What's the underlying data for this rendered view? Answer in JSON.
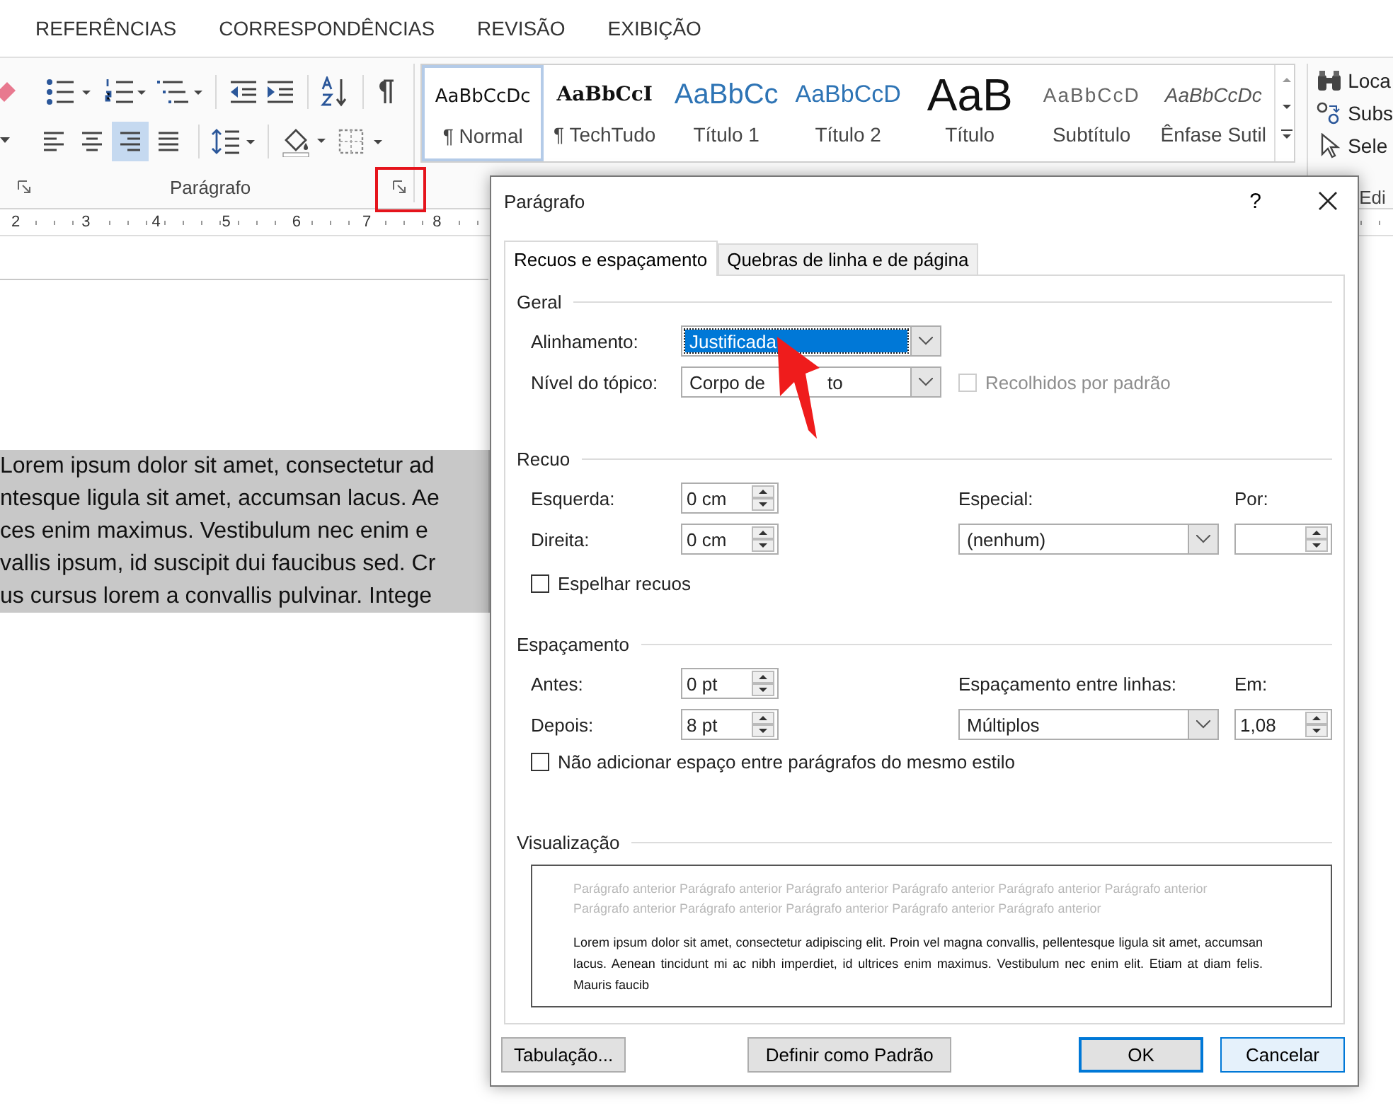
{
  "ribbon_tabs": [
    {
      "label": "REFERÊNCIAS"
    },
    {
      "label": "CORRESPONDÊNCIAS"
    },
    {
      "label": "REVISÃO"
    },
    {
      "label": "EXIBIÇÃO"
    }
  ],
  "paragraph_group": {
    "label": "Parágrafo",
    "launcher_highlighted": true,
    "alignment_buttons": [
      {
        "kind": "left",
        "selected": false
      },
      {
        "kind": "center",
        "selected": false
      },
      {
        "kind": "right",
        "selected": true
      },
      {
        "kind": "justify",
        "selected": false
      }
    ]
  },
  "styles": [
    {
      "sample": "AaBbCcDc",
      "name": "¶ Normal",
      "kind": "normal",
      "selected": true
    },
    {
      "sample": "AaBbCcI",
      "name": "¶ TechTudo",
      "kind": "custom",
      "selected": false
    },
    {
      "sample": "AaBbCc",
      "name": "Título 1",
      "kind": "heading1",
      "selected": false
    },
    {
      "sample": "AaBbCcD",
      "name": "Título 2",
      "kind": "heading2",
      "selected": false
    },
    {
      "sample": "AaB",
      "name": "Título",
      "kind": "title",
      "selected": false
    },
    {
      "sample": "AaBbCcD",
      "name": "Subtítulo",
      "kind": "subtitle",
      "selected": false
    },
    {
      "sample": "AaBbCcDc",
      "name": "Ênfase Sutil",
      "kind": "emphasis",
      "selected": false
    }
  ],
  "editing": {
    "label": "Edi",
    "items": [
      {
        "kind": "find",
        "label": "Loca"
      },
      {
        "kind": "replace",
        "label": "Subs"
      },
      {
        "kind": "select",
        "label": "Sele"
      }
    ]
  },
  "ruler": [
    "2",
    "3",
    "4",
    "5",
    "6",
    "7",
    "8"
  ],
  "document": {
    "lines": [
      "Lorem ipsum dolor sit amet, consectetur ad",
      "ntesque ligula sit amet, accumsan lacus. Ae",
      "ces enim maximus. Vestibulum nec enim e",
      "vallis ipsum, id suscipit dui faucibus sed. Cr",
      "us cursus lorem a convallis pulvinar. Intege"
    ]
  },
  "dialog": {
    "title": "Parágrafo",
    "help": "?",
    "tabs": [
      {
        "label": "Recuos e espaçamento",
        "selected": true
      },
      {
        "label": "Quebras de linha e de página",
        "selected": false
      }
    ],
    "general": {
      "title": "Geral",
      "alignment": {
        "label": "Alinhamento:",
        "value": "Justificada",
        "focused": true
      },
      "outline_level": {
        "label": "Nível do tópico:",
        "value_parts": [
          "Corpo de",
          "to"
        ],
        "focused": false
      },
      "collapsed": {
        "label": "Recolhidos por padrão",
        "checked": false,
        "disabled": true
      }
    },
    "indent": {
      "title": "Recuo",
      "left": {
        "label": "Esquerda:",
        "value": "0 cm"
      },
      "right": {
        "label": "Direita:",
        "value": "0 cm"
      },
      "special": {
        "label": "Especial:",
        "value": "(nenhum)"
      },
      "by": {
        "label": "Por:"
      },
      "mirror": {
        "label": "Espelhar recuos",
        "checked": false,
        "disabled": false
      }
    },
    "spacing": {
      "title": "Espaçamento",
      "before": {
        "label": "Antes:",
        "value": "0 pt"
      },
      "after": {
        "label": "Depois:",
        "value": "8 pt"
      },
      "line_spacing": {
        "label": "Espaçamento entre linhas:",
        "value": "Múltiplos"
      },
      "at": {
        "label": "Em:",
        "value": "1,08"
      },
      "no_space": {
        "label": "Não adicionar espaço entre parágrafos do mesmo estilo",
        "checked": false,
        "disabled": false
      }
    },
    "preview": {
      "title": "Visualização",
      "previous_text": "Parágrafo anterior Parágrafo anterior Parágrafo anterior Parágrafo anterior Parágrafo anterior Parágrafo anterior Parágrafo anterior Parágrafo anterior Parágrafo anterior Parágrafo anterior Parágrafo anterior",
      "sample_text": "Lorem ipsum dolor sit amet, consectetur adipiscing elit. Proin vel magna convallis, pellentesque ligula sit amet, accumsan lacus. Aenean tincidunt mi ac nibh imperdiet, id ultrices enim maximus. Vestibulum nec enim elit. Etiam at diam felis. Mauris faucib"
    },
    "buttons": [
      {
        "label": "Tabulação...",
        "default": false,
        "hovered": false
      },
      {
        "label": "Definir como Padrão",
        "default": false,
        "hovered": false
      },
      {
        "label": "OK",
        "default": true,
        "hovered": false
      },
      {
        "label": "Cancelar",
        "default": false,
        "hovered": true
      }
    ]
  }
}
